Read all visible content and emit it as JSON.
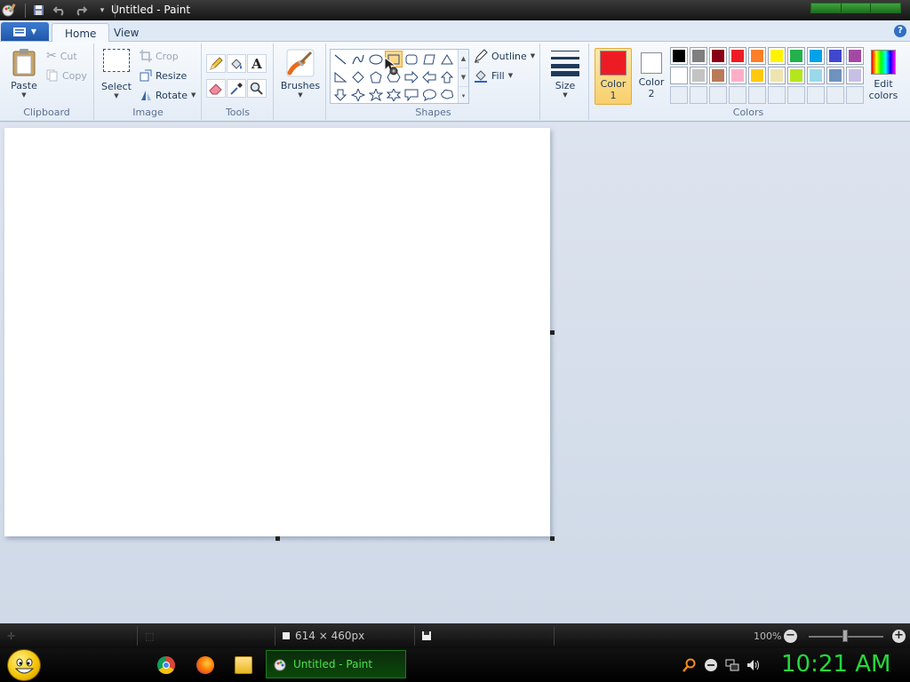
{
  "window": {
    "title": "Untitled - Paint"
  },
  "tabs": [
    {
      "label": "Home",
      "active": true
    },
    {
      "label": "View",
      "active": false
    }
  ],
  "groups": {
    "clipboard": {
      "label": "Clipboard",
      "paste": "Paste",
      "cut": "Cut",
      "copy": "Copy"
    },
    "image": {
      "label": "Image",
      "select": "Select",
      "crop": "Crop",
      "resize": "Resize",
      "rotate": "Rotate"
    },
    "tools": {
      "label": "Tools"
    },
    "brushes": {
      "label": "Brushes"
    },
    "shapes": {
      "label": "Shapes",
      "outline": "Outline",
      "fill": "Fill"
    },
    "size": {
      "label": "Size"
    },
    "colors": {
      "label": "Colors",
      "color1_line1": "Color",
      "color1_line2": "1",
      "color2_line1": "Color",
      "color2_line2": "2",
      "edit_line1": "Edit",
      "edit_line2": "colors",
      "color1_value": "#ed1c24",
      "color2_value": "#ffffff",
      "palette_row1": [
        "#000000",
        "#7f7f7f",
        "#880015",
        "#ed1c24",
        "#ff7f27",
        "#fff200",
        "#22b14c",
        "#00a2e8",
        "#3f48cc",
        "#a349a4"
      ],
      "palette_row2": [
        "#ffffff",
        "#c3c3c3",
        "#b97a57",
        "#ffaec9",
        "#ffc90e",
        "#efe4b0",
        "#b5e61d",
        "#99d9ea",
        "#7092be",
        "#c8bfe7"
      ]
    }
  },
  "status": {
    "dimensions": "614 × 460px",
    "zoom": "100%"
  },
  "taskbar": {
    "window_label": "Untitled - Paint",
    "clock": "10:21 AM"
  },
  "accent": {
    "title_bg": "#1a1a1a",
    "ribbon_bg": "#e4ecf6",
    "clock_green": "#25d83a"
  }
}
